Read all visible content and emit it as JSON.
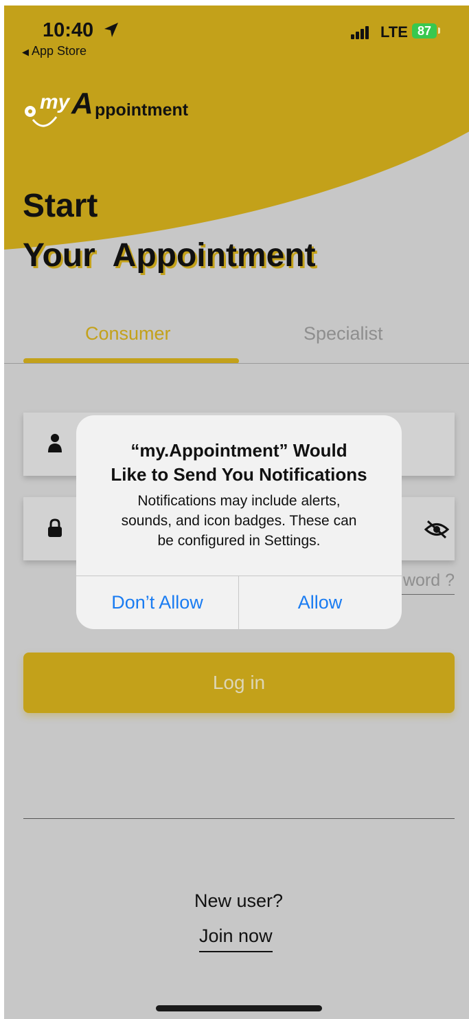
{
  "status_bar": {
    "time": "10:40",
    "back_app": "App Store",
    "network": "LTE",
    "battery": "87"
  },
  "logo": {
    "my": "my",
    "a": "A",
    "rest": "ppointment"
  },
  "headline": {
    "line1": "Start",
    "line2": "Your  Appointment"
  },
  "tabs": [
    {
      "label": "Consumer",
      "active": true
    },
    {
      "label": "Specialist",
      "active": false
    }
  ],
  "forgot_password_visible": "word ?",
  "login_button": "Log in",
  "footer": {
    "new_user": "New user?",
    "join": "Join now"
  },
  "dialog": {
    "title": "“my.Appointment” Would\nLike to Send You Notifications",
    "message": "Notifications may include alerts,\nsounds, and icon badges. These can\nbe configured in Settings.",
    "dont_allow": "Don’t Allow",
    "allow": "Allow"
  },
  "colors": {
    "brand": "#c3a11a",
    "background": "#c7c7c7",
    "ios_blue": "#1a7cf2"
  }
}
